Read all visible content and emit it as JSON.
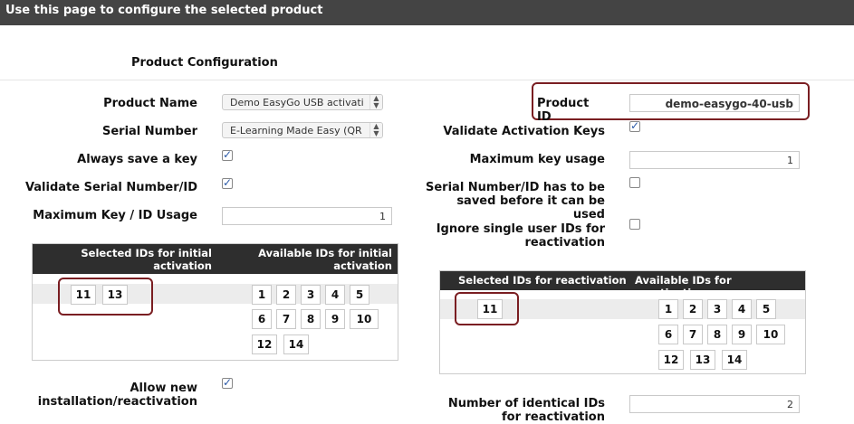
{
  "header": {
    "title": "Use this page to configure the selected product"
  },
  "section_title": "Product Configuration",
  "left": {
    "product_name_label": "Product Name",
    "product_name_value": "Demo EasyGo USB activati",
    "serial_number_label": "Serial Number",
    "serial_number_value": "E-Learning Made Easy (QR",
    "always_save_label": "Always save a key",
    "always_save_checked": true,
    "validate_serial_label": "Validate Serial Number/ID",
    "validate_serial_checked": true,
    "max_key_label": "Maximum Key / ID Usage",
    "max_key_value": "1",
    "initial_panel": {
      "selected_header": "Selected IDs for initial activation",
      "available_header": "Available IDs for initial activation",
      "selected_ids": [
        "11",
        "13"
      ],
      "available_ids": [
        "1",
        "2",
        "3",
        "4",
        "5",
        "6",
        "7",
        "8",
        "9",
        "10",
        "12",
        "14"
      ]
    },
    "allow_new_label": "Allow new installation/reactivation",
    "allow_new_checked": true
  },
  "right": {
    "product_id_label": "Product ID",
    "product_id_value": "demo-easygo-40-usb",
    "validate_activation_label": "Validate Activation Keys",
    "validate_activation_checked": true,
    "max_key_usage_label": "Maximum key usage",
    "max_key_usage_value": "1",
    "serial_saved_label": "Serial Number/ID has to be saved before it can be used",
    "serial_saved_checked": false,
    "ignore_single_label": "Ignore single user IDs for reactivation",
    "ignore_single_checked": false,
    "reactivation_panel": {
      "selected_header": "Selected IDs for reactivation",
      "available_header": "Available IDs for reactivation",
      "selected_ids": [
        "11"
      ],
      "available_ids": [
        "1",
        "2",
        "3",
        "4",
        "5",
        "6",
        "7",
        "8",
        "9",
        "10",
        "12",
        "13",
        "14"
      ]
    },
    "identical_ids_label": "Number of identical IDs for reactivation",
    "identical_ids_value": "2"
  },
  "colors": {
    "header_bg": "#444444",
    "panel_head_bg": "#2e2e2e",
    "highlight_border": "#7a1e22",
    "check_color": "#2b5aa8"
  }
}
